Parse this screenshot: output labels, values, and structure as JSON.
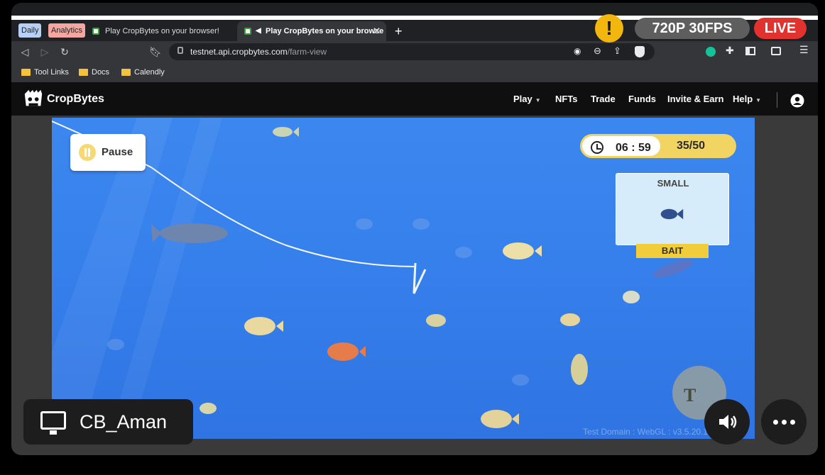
{
  "tabs": {
    "groups": [
      {
        "label": "Daily",
        "color": "#b9d0f5"
      },
      {
        "label": "Analytics",
        "color": "#f4a6a0"
      }
    ],
    "items": [
      {
        "title": "Play CropBytes on your browser!",
        "active": false
      },
      {
        "title": "Play CropBytes on your browse",
        "active": true
      }
    ],
    "new_tab": "+"
  },
  "address_bar": {
    "host": "testnet.api.cropbytes.com",
    "path": "/farm-view"
  },
  "bookmarks": [
    "Tool Links",
    "Docs",
    "Calendly"
  ],
  "site": {
    "brand": "CropBytes",
    "nav": [
      "Play",
      "NFTs",
      "Trade",
      "Funds",
      "Invite & Earn",
      "Help"
    ]
  },
  "game": {
    "pause_label": "Pause",
    "timer": "06 : 59",
    "score": "35/50",
    "bait_size": "SMALL",
    "bait_label": "BAIT",
    "footer": "Test Domain : WebGL : v3.5.20.123"
  },
  "stream": {
    "quality": "720P 30FPS",
    "live": "LIVE",
    "warning": "!",
    "user": "CB_Aman"
  },
  "colors": {
    "water": "#3680ec",
    "bait_tag": "#f2cd3b",
    "timer_accent": "#f2d463",
    "live_red": "#e2322e"
  }
}
